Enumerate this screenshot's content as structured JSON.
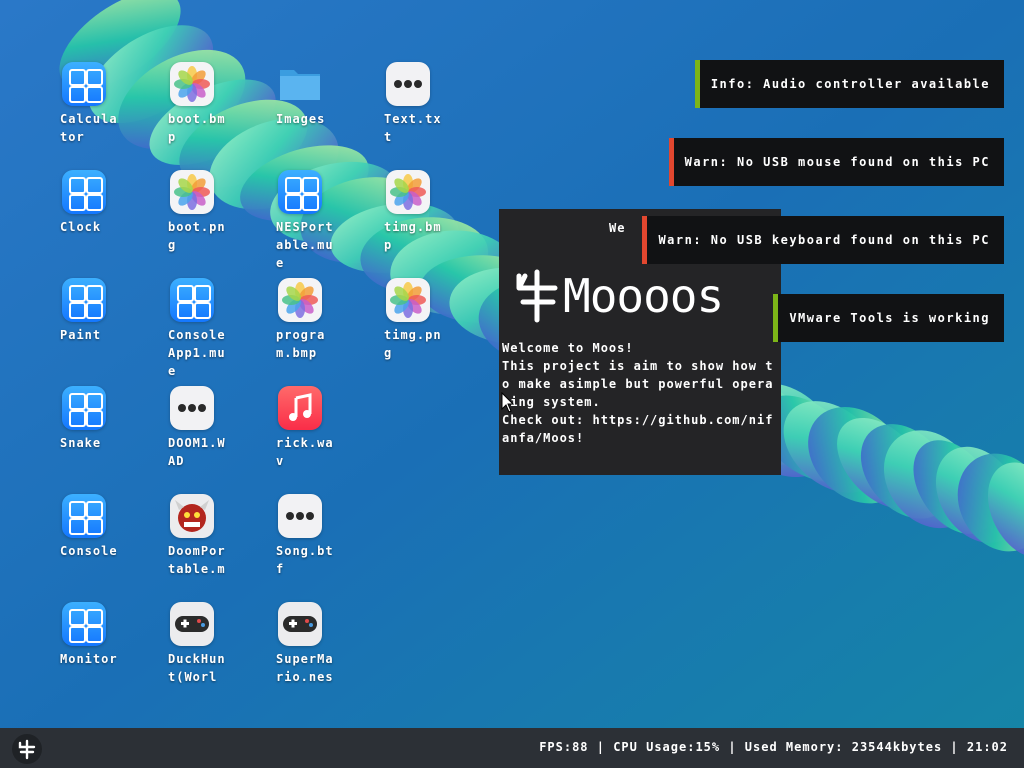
{
  "desktop": {
    "icons": [
      {
        "label": "Calculator",
        "type": "app"
      },
      {
        "label": "boot.bmp",
        "type": "photo"
      },
      {
        "label": "Images",
        "type": "folder"
      },
      {
        "label": "Text.txt",
        "type": "more"
      },
      {
        "label": "Clock",
        "type": "app"
      },
      {
        "label": "boot.png",
        "type": "photo"
      },
      {
        "label": "NESPortable.mue",
        "type": "app"
      },
      {
        "label": "timg.bmp",
        "type": "photo"
      },
      {
        "label": "Paint",
        "type": "app"
      },
      {
        "label": "ConsoleApp1.mue",
        "type": "app"
      },
      {
        "label": "program.bmp",
        "type": "photo"
      },
      {
        "label": "timg.png",
        "type": "photo"
      },
      {
        "label": "Snake",
        "type": "app"
      },
      {
        "label": "DOOM1.WAD",
        "type": "more"
      },
      {
        "label": "rick.wav",
        "type": "music"
      },
      {
        "label": "Console",
        "type": "app"
      },
      {
        "label": "DoomPortable.m",
        "type": "doom"
      },
      {
        "label": "Song.btf",
        "type": "more"
      },
      {
        "label": "Monitor",
        "type": "app"
      },
      {
        "label": "DuckHunt(Worl",
        "type": "gamepad"
      },
      {
        "label": "SuperMario.nes",
        "type": "gamepad"
      }
    ]
  },
  "notifications": [
    {
      "text": "Info: Audio controller available",
      "accent": "#7cb518"
    },
    {
      "text": "Warn: No USB mouse found on this PC",
      "accent": "#e2472f"
    },
    {
      "text": "Warn: No USB keyboard found on this PC",
      "accent": "#e2472f"
    },
    {
      "text": "VMware Tools is working",
      "accent": "#7cb518"
    }
  ],
  "welcome_window": {
    "title_fragment": "We",
    "logo_text": "Moooos",
    "body": "Welcome to Moos!\nThis project is aim to show how to make asimple but powerful operating system.\nCheck out: https://github.com/nifanfa/Moos!"
  },
  "taskbar": {
    "status": "FPS:88 | CPU Usage:15% | Used Memory: 23544kbytes | 21:02",
    "start_icon": "moos-logo-icon"
  }
}
